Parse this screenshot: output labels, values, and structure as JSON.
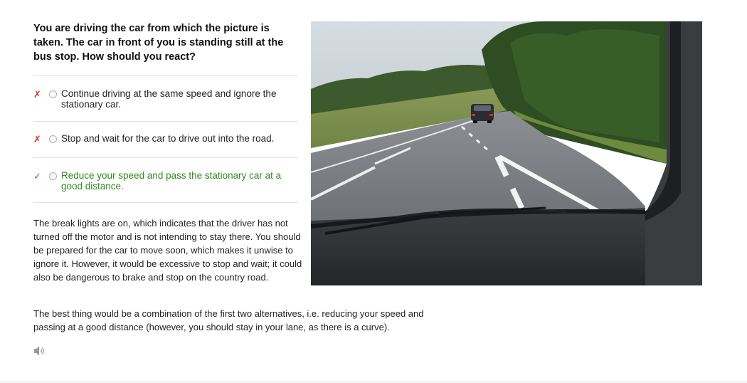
{
  "question": {
    "text": "You are driving the car from which the picture is taken. The car in front of you is standing still at the bus stop. How should you react?"
  },
  "answers": [
    {
      "mark": "✗",
      "text": "Continue driving at the same speed and ignore the stationary car.",
      "correct": false
    },
    {
      "mark": "✗",
      "text": "Stop and wait for the car to drive out into the road.",
      "correct": false
    },
    {
      "mark": "✓",
      "text": "Reduce your speed and pass the stationary car at a good distance.",
      "correct": true
    }
  ],
  "explanation": {
    "para1": "The break lights are on, which indicates that the driver has not turned off the motor and is not intending to stay there. You should be prepared for the car to move soon, which makes it unwise to ignore it. However, it would be excessive to stop and wait; it could also be dangerous to brake and stop on the country road.",
    "para2": "The best thing would be a combination of the first two alternatives, i.e. reducing your speed and passing at a good distance (however, you should stay in your lane, as there is a curve)."
  },
  "audio": {
    "icon": "speaker-icon"
  },
  "colors": {
    "wrong": "#d9312b",
    "correct": "#2f8a1f",
    "divider": "#e2e2e2"
  }
}
